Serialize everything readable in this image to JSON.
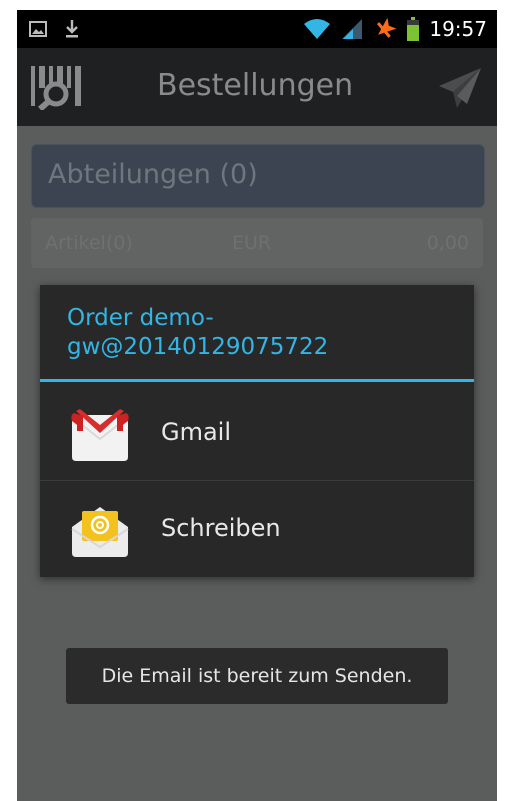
{
  "status_bar": {
    "time": "19:57",
    "icons": [
      "image-notification-icon",
      "download-icon",
      "wifi-icon",
      "signal-icon",
      "airplane-mode-icon",
      "battery-icon"
    ],
    "colors": {
      "wifi": "#33b5e5",
      "airplane": "#ff6b1a",
      "battery": "#7cc233"
    }
  },
  "action_bar": {
    "title": "Bestellungen",
    "logo_icon": "barcode-scanner-logo-icon",
    "send_icon": "send-paper-plane-icon"
  },
  "departments": {
    "label": "Abteilungen (0)"
  },
  "summary": {
    "articles": "Artikel(0)",
    "currency": "EUR",
    "total": "0,00"
  },
  "dialog": {
    "title": "Order demo-gw@20140129075722",
    "accent": "#33b5e5",
    "options": [
      {
        "label": "Gmail",
        "icon": "gmail-icon"
      },
      {
        "label": "Schreiben",
        "icon": "email-compose-icon"
      }
    ]
  },
  "toast": {
    "text": "Die Email ist bereit zum Senden."
  }
}
